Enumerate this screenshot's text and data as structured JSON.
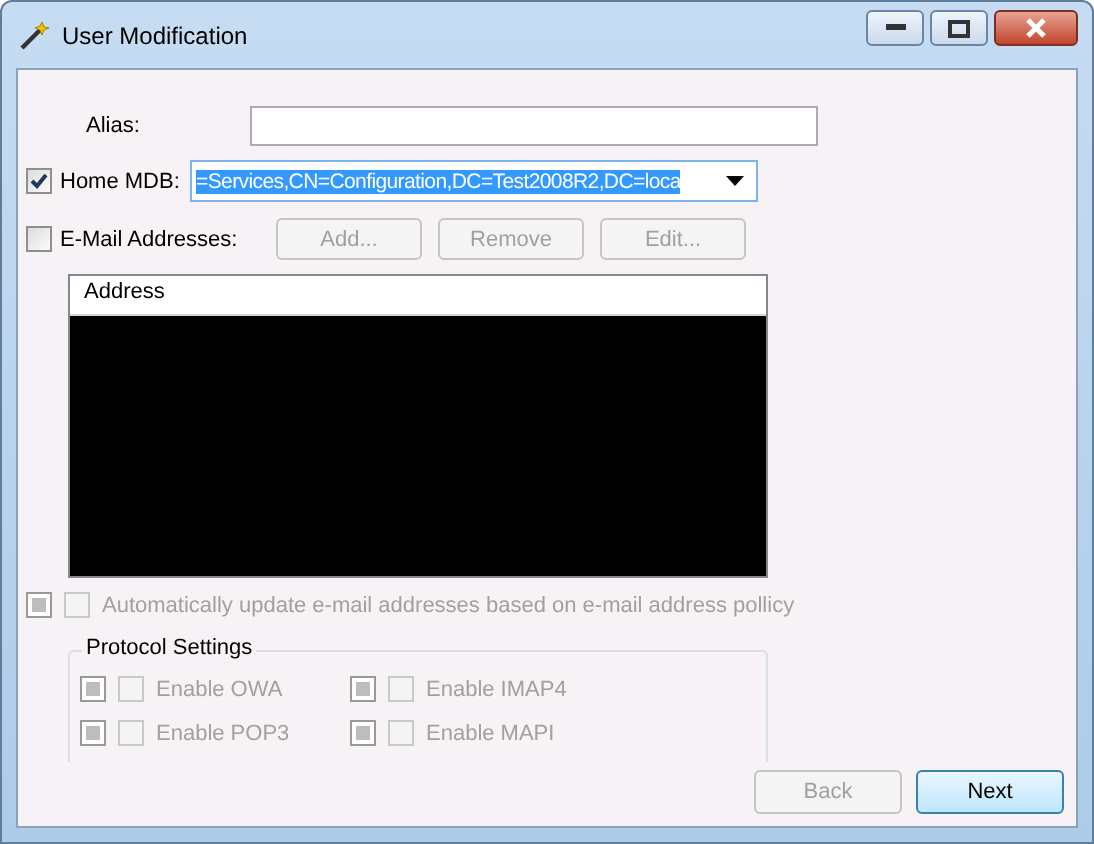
{
  "window": {
    "title": "User Modification"
  },
  "alias": {
    "label": "Alias:"
  },
  "home_mdb": {
    "label": "Home MDB:",
    "checked": true,
    "value": "=Services,CN=Configuration,DC=Test2008R2,DC=loca",
    "selected": true
  },
  "email": {
    "label": "E-Mail Addresses:",
    "checked": false,
    "buttons": [
      {
        "label": "Add...",
        "disabled": true
      },
      {
        "label": "Remove",
        "disabled": true
      },
      {
        "label": "Edit...",
        "disabled": true
      }
    ]
  },
  "address_list": {
    "columns": [
      "Address"
    ]
  },
  "auto_update": {
    "label": "Automatically update e-mail addresses based on e-mail address pollicy",
    "override_checked": false,
    "checked": false,
    "disabled": true
  },
  "protocol_settings": {
    "title": "Protocol Settings",
    "options": [
      {
        "label": "Enable OWA",
        "override_checked": false,
        "checked": false,
        "disabled": true
      },
      {
        "label": "Enable IMAP4",
        "override_checked": false,
        "checked": false,
        "disabled": true
      },
      {
        "label": "Enable POP3",
        "override_checked": false,
        "checked": false,
        "disabled": true
      },
      {
        "label": "Enable MAPI",
        "override_checked": false,
        "checked": false,
        "disabled": true
      }
    ]
  },
  "buttons": [
    {
      "label": "Back",
      "disabled": true,
      "default": false
    },
    {
      "label": "Next",
      "disabled": false,
      "default": true
    }
  ]
}
